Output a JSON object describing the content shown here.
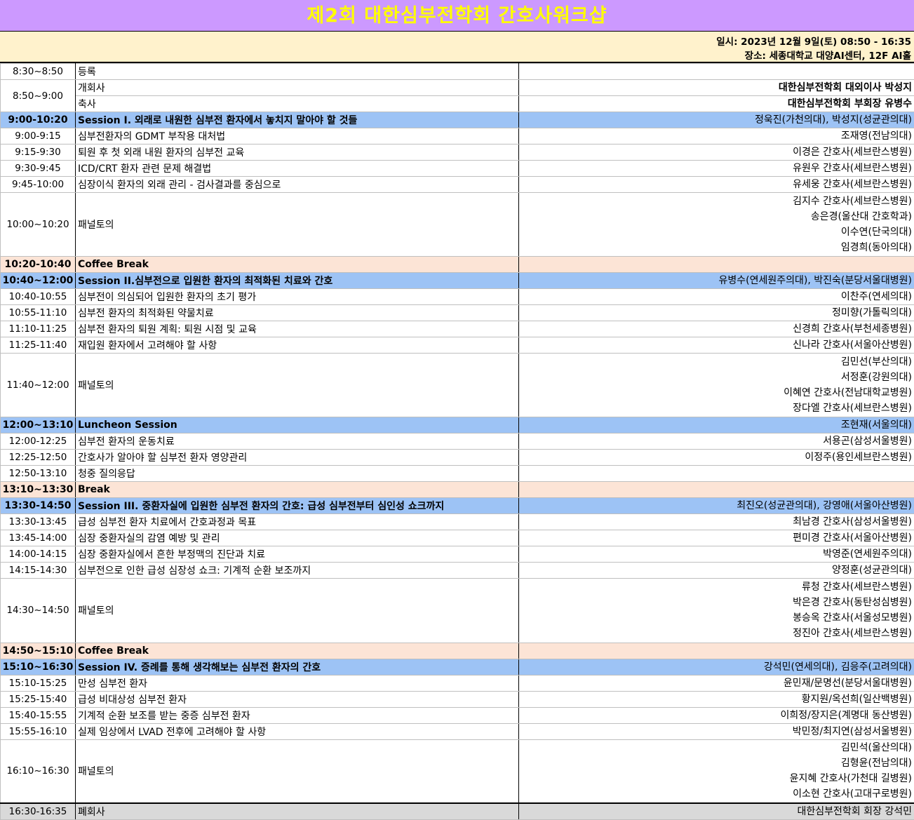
{
  "title": "제2회 대한심부전학회 간호사워크샵",
  "info": {
    "date": "일시: 2023년 12월 9일(토) 08:50 - 16:35",
    "place": "장소: 세종대학교 대양AI센터, 12F AI홀"
  },
  "rows": [
    {
      "type": "normal",
      "time": "8:30~8:50",
      "topic": "등록",
      "speakers": [
        ""
      ]
    },
    {
      "type": "normal",
      "time": "8:50~9:00",
      "topic": "개회사",
      "speakers": [
        "대한심부전학회 대외이사 박성지"
      ],
      "bold": true,
      "span": 2
    },
    {
      "type": "normal",
      "time": null,
      "topic": "축사",
      "speakers": [
        "대한심부전학회 부회장 유병수"
      ],
      "bold": true
    },
    {
      "type": "session",
      "time": "9:00-10:20",
      "topic": "Session I. 외래로 내원한 심부전 환자에서 놓치지 말아야 할 것들",
      "speakers": [
        "정욱진(가천의대), 박성지(성균관의대)"
      ]
    },
    {
      "type": "normal",
      "time": "9:00-9:15",
      "topic": "심부전환자의 GDMT 부작용 대처법",
      "speakers": [
        "조재영(전남의대)"
      ]
    },
    {
      "type": "normal",
      "time": "9:15-9:30",
      "topic": "퇴원 후 첫 외래 내원 환자의 심부전 교육",
      "speakers": [
        "이경은 간호사(세브란스병원)"
      ]
    },
    {
      "type": "normal",
      "time": "9:30-9:45",
      "topic": "ICD/CRT 환자 관련 문제 해결법",
      "speakers": [
        "유원우 간호사(세브란스병원)"
      ]
    },
    {
      "type": "normal",
      "time": "9:45-10:00",
      "topic": "심장이식 환자의 외래 관리 - 검사결과를 중심으로",
      "speakers": [
        "유세웅 간호사(세브란스병원)"
      ]
    },
    {
      "type": "normal",
      "time": "10:00~10:20",
      "topic": "패널토의",
      "speakers": [
        "김지수 간호사(세브란스병원)",
        "송은경(울산대 간호학과)",
        "이수연(단국의대)",
        "임경희(동아의대)"
      ]
    },
    {
      "type": "break",
      "time": "10:20-10:40",
      "topic": "Coffee Break",
      "speakers": [
        ""
      ]
    },
    {
      "type": "session",
      "time": "10:40~12:00",
      "topic": "Session II.심부전으로 입원한 환자의 최적화된 치료와 간호",
      "speakers": [
        "유병수(연세원주의대), 박진숙(분당서울대병원)"
      ]
    },
    {
      "type": "normal",
      "time": "10:40-10:55",
      "topic": "심부전이 의심되어 입원한 환자의 초기 평가",
      "speakers": [
        "이찬주(연세의대)"
      ]
    },
    {
      "type": "normal",
      "time": "10:55-11:10",
      "topic": "심부전 환자의 최적화된 약물치료",
      "speakers": [
        "정미향(가톨릭의대)"
      ]
    },
    {
      "type": "normal",
      "time": "11:10-11:25",
      "topic": "심부전 환자의 퇴원 계획: 퇴원 시점 및 교육",
      "speakers": [
        "신경희 간호사(부천세종병원)"
      ]
    },
    {
      "type": "normal",
      "time": "11:25-11:40",
      "topic": "재입원 환자에서 고려해야 할 사항",
      "speakers": [
        "신나라 간호사(서울아산병원)"
      ]
    },
    {
      "type": "normal",
      "time": "11:40~12:00",
      "topic": "패널토의",
      "speakers": [
        "김민선(부산의대)",
        "서정훈(강원의대)",
        "이혜연 간호사(전남대학교병원)",
        "장다엘 간호사(세브란스병원)"
      ]
    },
    {
      "type": "session",
      "time": "12:00~13:10",
      "topic": "Luncheon Session",
      "speakers": [
        "조현재(서울의대)"
      ]
    },
    {
      "type": "normal",
      "time": "12:00-12:25",
      "topic": "심부전 환자의 운동치료",
      "speakers": [
        "서용곤(삼성서울병원)"
      ]
    },
    {
      "type": "normal",
      "time": "12:25-12:50",
      "topic": "간호사가 알아야 할 심부전 환자 영양관리",
      "speakers": [
        "이정주(용인세브란스병원)"
      ]
    },
    {
      "type": "normal",
      "time": "12:50-13:10",
      "topic": "청중 질의응답",
      "speakers": [
        ""
      ]
    },
    {
      "type": "break",
      "time": "13:10~13:30",
      "topic": "Break",
      "speakers": [
        ""
      ]
    },
    {
      "type": "session",
      "time": "13:30-14:50",
      "topic": "Session III. 중환자실에 입원한 심부전 환자의 간호: 급성 심부전부터 심인성 쇼크까지",
      "speakers": [
        "최진오(성균관의대), 강영애(서울아산병원)"
      ]
    },
    {
      "type": "normal",
      "time": "13:30-13:45",
      "topic": "급성 심부전 환자 치료에서 간호과정과 목표",
      "speakers": [
        "최남경 간호사(삼성서울병원)"
      ]
    },
    {
      "type": "normal",
      "time": "13:45-14:00",
      "topic": "심장 중환자실의 감염 예방 및 관리",
      "speakers": [
        "편미경 간호사(서울아산병원)"
      ]
    },
    {
      "type": "normal",
      "time": "14:00-14:15",
      "topic": "심장 중환자실에서 흔한 부정맥의 진단과 치료",
      "speakers": [
        "박영준(연세원주의대)"
      ]
    },
    {
      "type": "normal",
      "time": "14:15-14:30",
      "topic": "심부전으로 인한 급성 심장성 쇼크: 기계적 순환 보조까지",
      "speakers": [
        "양정훈(성균관의대)"
      ]
    },
    {
      "type": "normal",
      "time": "14:30~14:50",
      "topic": "패널토의",
      "speakers": [
        "류청 간호사(세브란스병원)",
        "박은경 간호사(동탄성심병원)",
        "봉승옥 간호사(서울성모병원)",
        "정진아 간호사(세브란스병원)"
      ]
    },
    {
      "type": "break",
      "time": "14:50~15:10",
      "topic": "Coffee Break",
      "speakers": [
        ""
      ]
    },
    {
      "type": "session",
      "time": "15:10~16:30",
      "topic": "Session IV. 증례를 통해 생각해보는 심부전 환자의 간호",
      "speakers": [
        "강석민(연세의대), 김응주(고려의대)"
      ]
    },
    {
      "type": "normal",
      "time": "15:10-15:25",
      "topic": "만성 심부전 환자",
      "speakers": [
        "윤민재/문명선(분당서울대병원)"
      ]
    },
    {
      "type": "normal",
      "time": "15:25-15:40",
      "topic": "급성 비대상성 심부전 환자",
      "speakers": [
        "황지원/옥선희(일산백병원)"
      ]
    },
    {
      "type": "normal",
      "time": "15:40-15:55",
      "topic": "기계적 순환 보조를 받는 중증 심부전 환자",
      "speakers": [
        "이희정/장지은(계명대 동산병원)"
      ]
    },
    {
      "type": "normal",
      "time": "15:55-16:10",
      "topic": "실제 임상에서 LVAD 전후에 고려해야 할 사항",
      "speakers": [
        "박민정/최지연(삼성서울병원)"
      ]
    },
    {
      "type": "normal",
      "time": "16:10~16:30",
      "topic": "패널토의",
      "speakers": [
        "김민석(울산의대)",
        "김형윤(전남의대)",
        "윤지혜 간호사(가천대 길병원)",
        "이소현 간호사(고대구로병원)"
      ]
    },
    {
      "type": "closing",
      "time": "16:30-16:35",
      "topic": "폐회사",
      "speakers": [
        "대한심부전학회 회장 강석민"
      ]
    }
  ]
}
